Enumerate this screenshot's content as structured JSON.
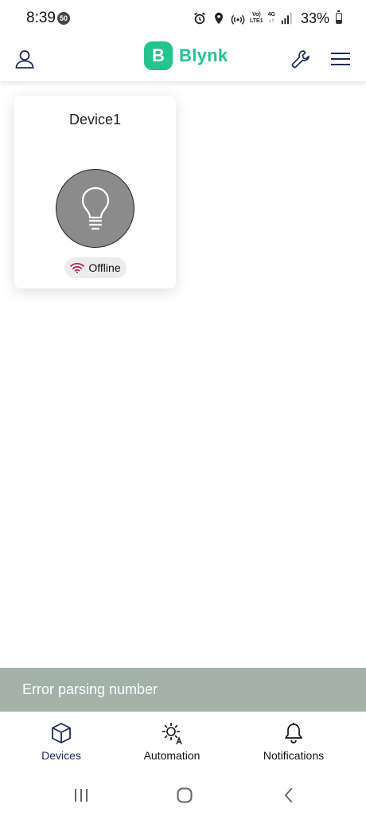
{
  "status_bar": {
    "time": "8:39",
    "notification_count": "50",
    "network_label_top": "Vo)",
    "network_label_bottom": "LTE1",
    "network_type": "4G",
    "battery": "33%"
  },
  "header": {
    "logo_letter": "B",
    "logo_text": "Blynk"
  },
  "device": {
    "name": "Device1",
    "status": "Offline"
  },
  "snackbar": {
    "message": "Error parsing number"
  },
  "bottom_nav": {
    "items": [
      {
        "label": "Devices"
      },
      {
        "label": "Automation"
      },
      {
        "label": "Notifications"
      }
    ]
  },
  "colors": {
    "brand": "#23c48e",
    "active_nav": "#1b2a58",
    "offline_icon": "#a3174a",
    "snackbar_bg": "#a2b1aa",
    "bulb_bg": "#8b8b8b"
  }
}
